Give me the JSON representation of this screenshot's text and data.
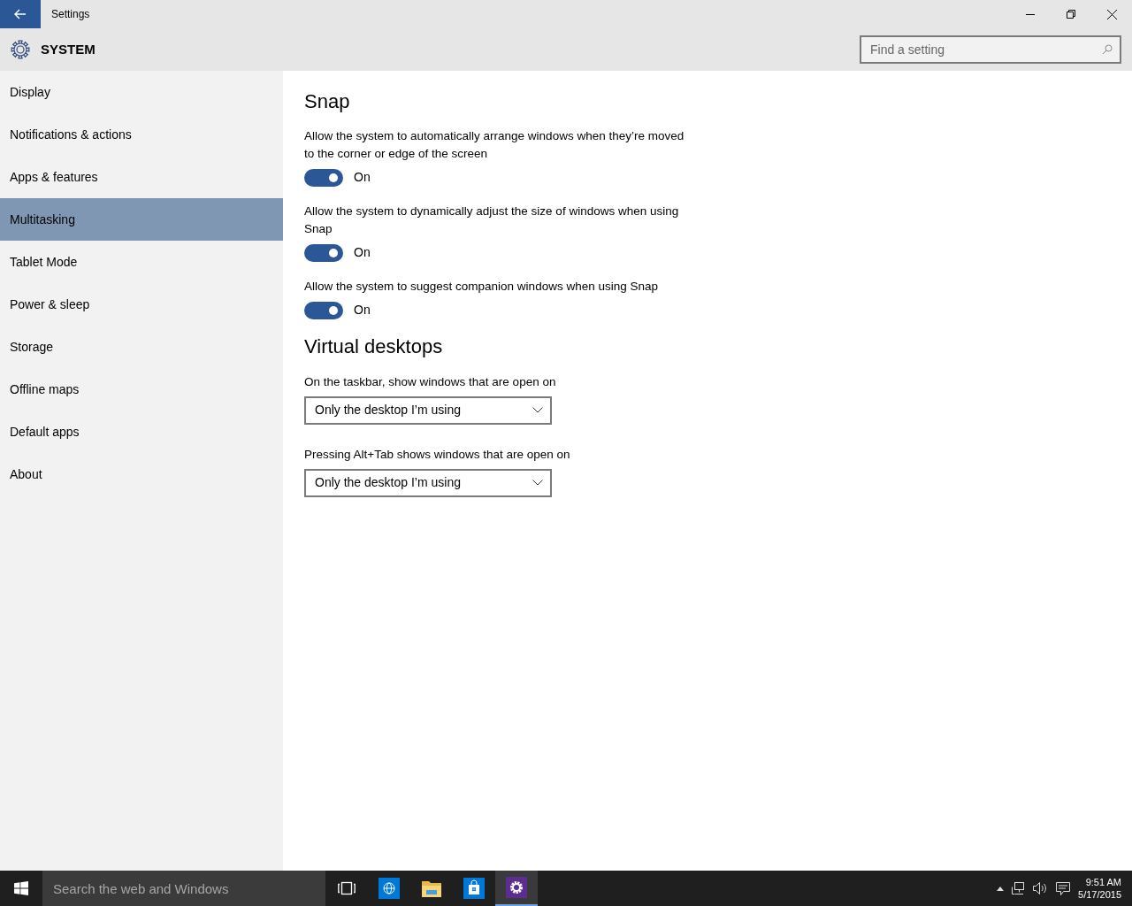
{
  "window": {
    "title": "Settings"
  },
  "header": {
    "title": "SYSTEM",
    "search": {
      "placeholder": "Find a setting"
    }
  },
  "sidebar": {
    "items": [
      {
        "label": "Display",
        "selected": false
      },
      {
        "label": "Notifications & actions",
        "selected": false
      },
      {
        "label": "Apps & features",
        "selected": false
      },
      {
        "label": "Multitasking",
        "selected": true
      },
      {
        "label": "Tablet Mode",
        "selected": false
      },
      {
        "label": "Power & sleep",
        "selected": false
      },
      {
        "label": "Storage",
        "selected": false
      },
      {
        "label": "Offline maps",
        "selected": false
      },
      {
        "label": "Default apps",
        "selected": false
      },
      {
        "label": "About",
        "selected": false
      }
    ]
  },
  "sections": [
    {
      "heading": "Snap",
      "settings": [
        {
          "kind": "toggle",
          "description": "Allow the system to automatically arrange windows when they’re moved to the corner or edge of the screen",
          "on": true,
          "state_label": "On"
        },
        {
          "kind": "toggle",
          "description": "Allow the system to dynamically adjust the size of windows when using Snap",
          "on": true,
          "state_label": "On"
        },
        {
          "kind": "toggle",
          "description": "Allow the system to suggest companion windows when using Snap",
          "on": true,
          "state_label": "On"
        }
      ]
    },
    {
      "heading": "Virtual desktops",
      "settings": [
        {
          "kind": "dropdown",
          "description": "On the taskbar, show windows that are open on",
          "value": "Only the desktop I’m using"
        },
        {
          "kind": "dropdown",
          "description": "Pressing Alt+Tab shows windows that are open on",
          "value": "Only the desktop I’m using"
        }
      ]
    }
  ],
  "taskbar": {
    "search": {
      "placeholder": "Search the web and Windows"
    },
    "apps": [
      {
        "kind": "task-view",
        "selected": false
      },
      {
        "kind": "browser",
        "selected": false
      },
      {
        "kind": "folder",
        "selected": false
      },
      {
        "kind": "store",
        "selected": false
      },
      {
        "kind": "settings",
        "selected": true
      }
    ],
    "clock": {
      "time": "9:51 AM",
      "date": "5/17/2015"
    }
  }
}
